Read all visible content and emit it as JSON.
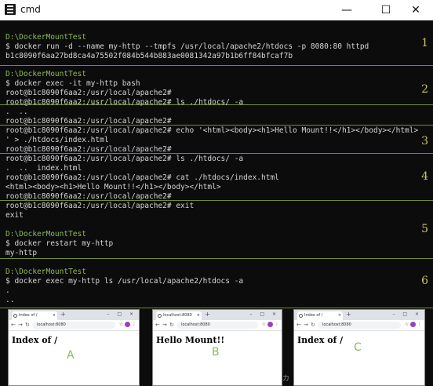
{
  "window": {
    "title": "cmd",
    "minimize_glyph": "—",
    "maximize_glyph": "☐",
    "close_glyph": "✕"
  },
  "terminal": {
    "lines": [
      {
        "text": "D:\\DockerMountTest",
        "kind": "prompt"
      },
      {
        "text": "$ docker run -d --name my-http --tmpfs /usr/local/apache2/htdocs -p 8080:80 httpd",
        "kind": "output"
      },
      {
        "text": "b1c8090f6aa27bd8ca4a75502f084b544b883ae0081342a97b1b6ff84bfcaf7b",
        "kind": "output"
      },
      {
        "text": "D:\\DockerMountTest",
        "kind": "prompt"
      },
      {
        "text": "$ docker exec -it my-http bash",
        "kind": "output"
      },
      {
        "text": "root@b1c8090f6aa2:/usr/local/apache2#",
        "kind": "output"
      },
      {
        "text": "root@b1c8090f6aa2:/usr/local/apache2# ls ./htdocs/ -a",
        "kind": "output"
      },
      {
        "text": ".  ..",
        "kind": "output"
      },
      {
        "text": "root@b1c8090f6aa2:/usr/local/apache2#",
        "kind": "output"
      },
      {
        "text": "root@b1c8090f6aa2:/usr/local/apache2# echo '<html><body><h1>Hello Mount!!</h1></body></html>",
        "kind": "output"
      },
      {
        "text": "' > ./htdocs/index.html",
        "kind": "output"
      },
      {
        "text": "root@b1c8090f6aa2:/usr/local/apache2#",
        "kind": "output"
      },
      {
        "text": "root@b1c8090f6aa2:/usr/local/apache2# ls ./htdocs/ -a",
        "kind": "output"
      },
      {
        "text": ".  ..  index.html",
        "kind": "output"
      },
      {
        "text": "root@b1c8090f6aa2:/usr/local/apache2# cat ./htdocs/index.html",
        "kind": "output"
      },
      {
        "text": "<html><body><h1>Hello Mount!!</h1></body></html>",
        "kind": "output"
      },
      {
        "text": "root@b1c8090f6aa2:/usr/local/apache2#",
        "kind": "output"
      },
      {
        "text": "root@b1c8090f6aa2:/usr/local/apache2# exit",
        "kind": "output"
      },
      {
        "text": "exit",
        "kind": "output"
      },
      {
        "text": "",
        "kind": "output"
      },
      {
        "text": "D:\\DockerMountTest",
        "kind": "prompt"
      },
      {
        "text": "$ docker restart my-http",
        "kind": "output"
      },
      {
        "text": "my-http",
        "kind": "output"
      },
      {
        "text": "",
        "kind": "output"
      },
      {
        "text": "D:\\DockerMountTest",
        "kind": "prompt"
      },
      {
        "text": "$ docker exec my-http ls /usr/local/apache2/htdocs -a",
        "kind": "output"
      },
      {
        "text": ".",
        "kind": "output"
      },
      {
        "text": "..",
        "kind": "output"
      }
    ],
    "step_numbers": [
      "1",
      "2",
      "3",
      "4",
      "5",
      "6"
    ]
  },
  "browser_shots": [
    {
      "tab_title": "Index of /",
      "url": "localhost:8080",
      "heading": "Index of /",
      "label": "A"
    },
    {
      "tab_title": "localhost:8080",
      "url": "localhost:8080",
      "heading": "Hello Mount!!",
      "label": "B"
    },
    {
      "tab_title": "Index of /",
      "url": "localhost:8080",
      "heading": "Index of /",
      "label": "C"
    }
  ],
  "ime_indicator": "カ",
  "colors": {
    "prompt": "#8fb95a",
    "separator": "#6f8f2e",
    "step_number": "#c9c36a"
  }
}
